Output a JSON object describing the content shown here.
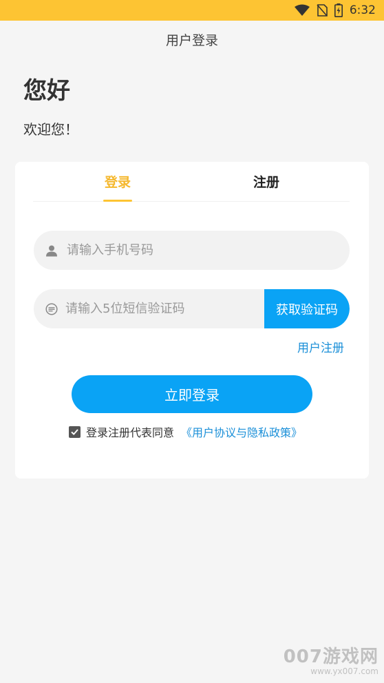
{
  "status_bar": {
    "time": "6:32",
    "icons": [
      "wifi-icon",
      "no-sim-icon",
      "battery-charging-icon"
    ]
  },
  "nav": {
    "title": "用户登录"
  },
  "greeting": {
    "title": "您好",
    "subtitle": "欢迎您！"
  },
  "tabs": [
    {
      "label": "登录",
      "active": true
    },
    {
      "label": "注册",
      "active": false
    }
  ],
  "form": {
    "phone": {
      "placeholder": "请输入手机号码",
      "value": "",
      "icon": "user-icon"
    },
    "code": {
      "placeholder": "请输入5位短信验证码",
      "value": "",
      "icon": "sms-icon"
    },
    "get_code_label": "获取验证码",
    "register_link": "用户注册",
    "login_label": "立即登录",
    "agree_text": "登录注册代表同意",
    "policy_link": "《用户协议与隐私政策》",
    "agree_checked": true
  },
  "watermark": {
    "main": "007游戏网",
    "url": "www.yx007.com"
  },
  "colors": {
    "status_bar": "#fdc433",
    "accent_yellow": "#f5b82e",
    "primary_blue": "#0aa3f5",
    "link_blue": "#1a8fd8",
    "background": "#f5f5f5"
  }
}
